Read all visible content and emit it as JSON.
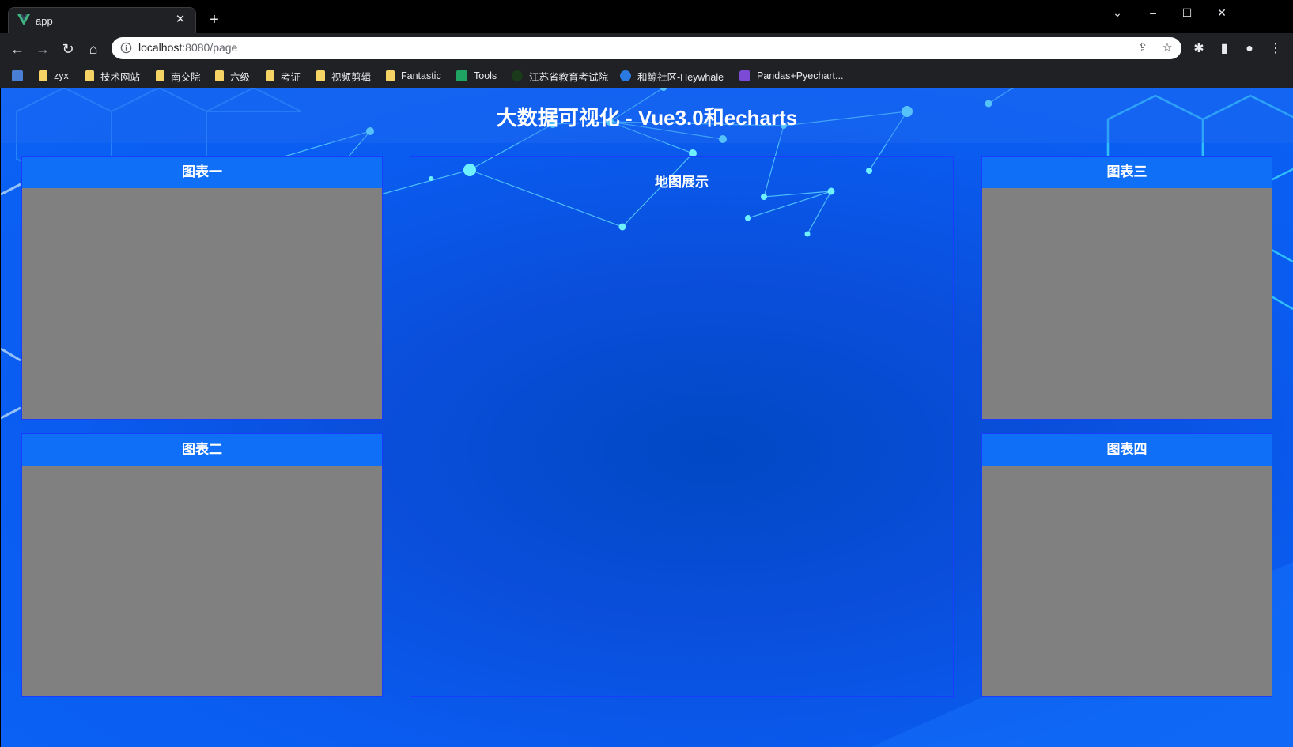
{
  "browser": {
    "tab_title": "app",
    "url_host": "localhost",
    "url_rest": ":8080/page"
  },
  "bookmarks": [
    {
      "label": "zyx",
      "icon": "folder-icon"
    },
    {
      "label": "技术网站",
      "icon": "folder-icon"
    },
    {
      "label": "南交院",
      "icon": "folder-icon"
    },
    {
      "label": "六级",
      "icon": "folder-icon"
    },
    {
      "label": "考证",
      "icon": "folder-icon"
    },
    {
      "label": "视频剪辑",
      "icon": "folder-icon"
    },
    {
      "label": "Fantastic",
      "icon": "folder-icon"
    },
    {
      "label": "Tools",
      "icon": "tools-icon"
    },
    {
      "label": "江苏省教育考试院",
      "icon": "site-icon"
    },
    {
      "label": "和鲸社区-Heywhale",
      "icon": "heywhale-icon"
    },
    {
      "label": "Pandas+Pyechart...",
      "icon": "pyechart-icon"
    }
  ],
  "page": {
    "title": "大数据可视化 - Vue3.0和echarts",
    "panels": {
      "chart1": "图表一",
      "chart2": "图表二",
      "map": "地图展示",
      "chart3": "图表三",
      "chart4": "图表四"
    }
  },
  "colors": {
    "page_bg": "#0a5cf0",
    "panel_head": "#0f6ff7",
    "panel_body": "#808080",
    "panel_border": "#1a3cff"
  }
}
